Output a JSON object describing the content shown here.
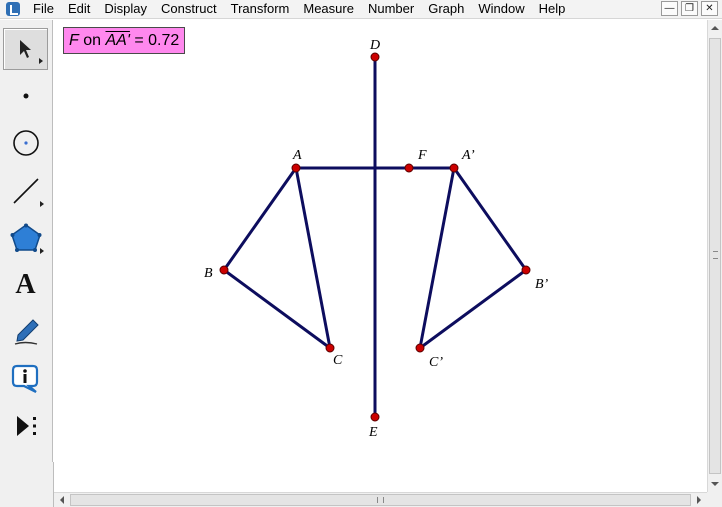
{
  "menu": {
    "items": [
      "File",
      "Edit",
      "Display",
      "Construct",
      "Transform",
      "Measure",
      "Number",
      "Graph",
      "Window",
      "Help"
    ]
  },
  "window_controls": {
    "minimize": "—",
    "restore": "❐",
    "close": "✕"
  },
  "toolbox": {
    "tools": [
      {
        "id": "arrow",
        "icon": "arrow-select-icon",
        "selected": true
      },
      {
        "id": "point",
        "icon": "point-tool-icon"
      },
      {
        "id": "compass",
        "icon": "compass-tool-icon"
      },
      {
        "id": "straightedge",
        "icon": "straightedge-tool-icon"
      },
      {
        "id": "polygon",
        "icon": "polygon-tool-icon"
      },
      {
        "id": "text",
        "icon": "text-tool-icon",
        "glyph": "A"
      },
      {
        "id": "marker",
        "icon": "marker-tool-icon"
      },
      {
        "id": "information",
        "icon": "information-tool-icon"
      },
      {
        "id": "custom",
        "icon": "custom-tool-icon"
      }
    ]
  },
  "measurement": {
    "point": "F",
    "connector": "on",
    "segment": "AA'",
    "equals": "=",
    "value": "0.72"
  },
  "points": {
    "A": "A",
    "A_prime": "A’",
    "B": "B",
    "B_prime": "B’",
    "C": "C",
    "C_prime": "C’",
    "D": "D",
    "E": "E",
    "F": "F"
  },
  "colors": {
    "segment": "#0d0d5e",
    "point_fill": "#cc0000",
    "measure_bg": "#ff88ee"
  }
}
